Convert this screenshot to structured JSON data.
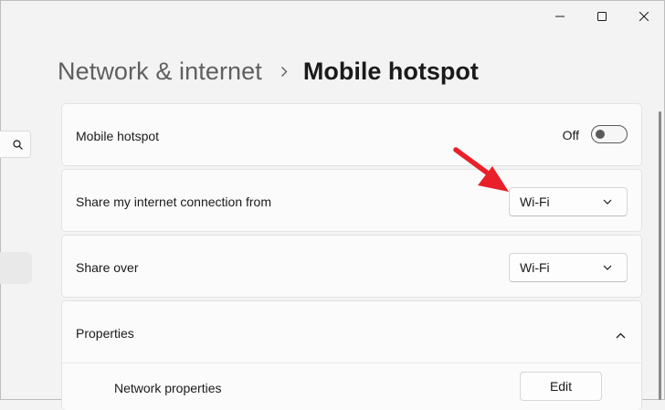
{
  "window": {
    "caption_icons": [
      "minimize-icon",
      "maximize-icon",
      "close-icon"
    ]
  },
  "nav": {
    "search_icon": "search-icon"
  },
  "breadcrumb": {
    "parent": "Network & internet",
    "current": "Mobile hotspot"
  },
  "settings": {
    "hotspot": {
      "label": "Mobile hotspot",
      "state_label": "Off",
      "enabled": false
    },
    "share_from": {
      "label": "Share my internet connection from",
      "value": "Wi-Fi"
    },
    "share_over": {
      "label": "Share over",
      "value": "Wi-Fi"
    },
    "properties": {
      "label": "Properties",
      "expanded": true,
      "network_properties_label": "Network properties",
      "edit_label": "Edit"
    }
  },
  "colors": {
    "background": "#f3f3f3",
    "card": "#fbfbfb",
    "annotation_arrow": "#e8202a"
  }
}
